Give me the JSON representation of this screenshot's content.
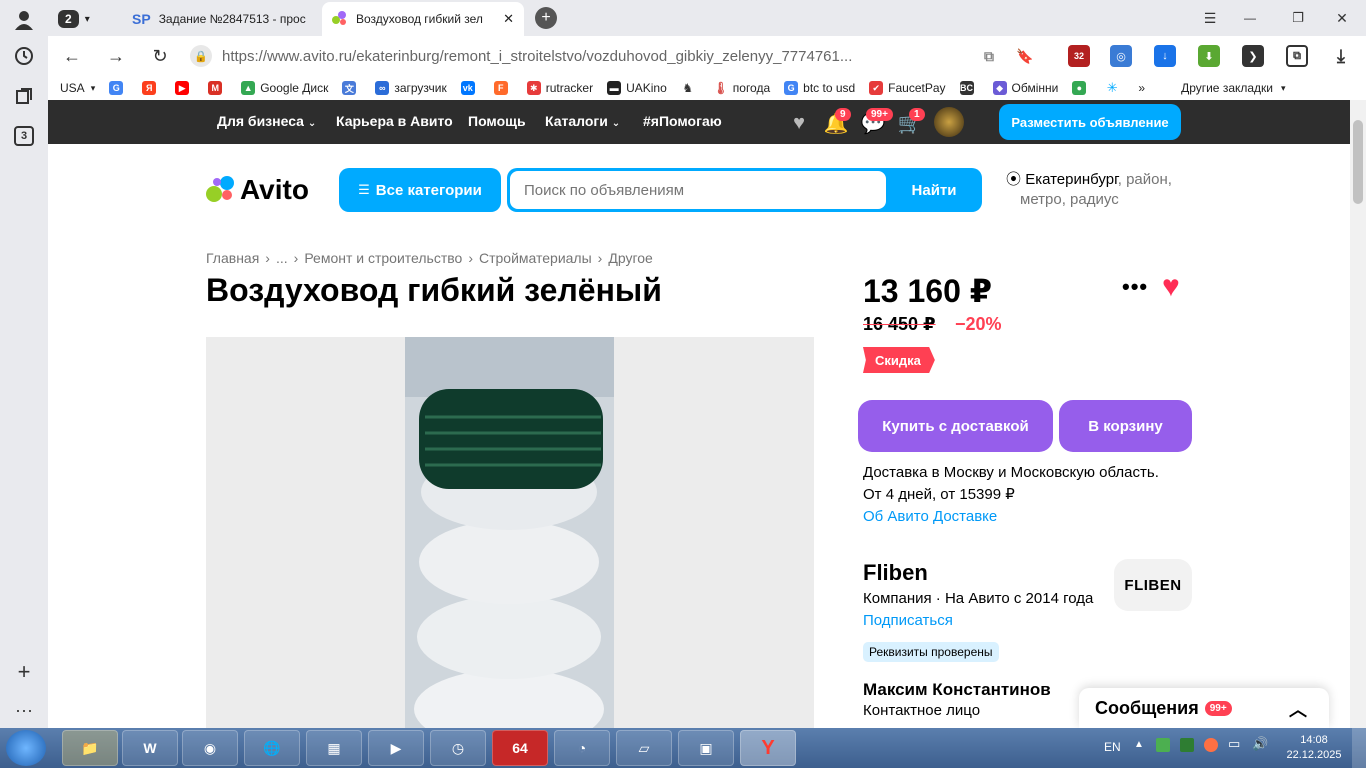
{
  "browser": {
    "rail": {
      "tab_count_badge": "2",
      "stack_badge": "3"
    },
    "tabs": [
      {
        "label": "Задание №2847513 - прос"
      },
      {
        "label": "Воздуховод гибкий зел"
      }
    ],
    "sp_favicon": "SP",
    "url": "https://www.avito.ru/ekaterinburg/remont_i_stroitelstvo/vozduhovod_gibkiy_zelenyy_7774761...",
    "ext_badge": "32",
    "bookmarks": [
      {
        "label": "USA",
        "icon": "chevron-down-icon",
        "color": "#999999"
      },
      {
        "label": "",
        "icon": "google-icon",
        "color": "#4285f4"
      },
      {
        "label": "",
        "icon": "yandex-icon",
        "color": "#fc3f1d"
      },
      {
        "label": "",
        "icon": "youtube-icon",
        "color": "#ff0000"
      },
      {
        "label": "",
        "icon": "gmail-icon",
        "color": "#d93025"
      },
      {
        "label": "Google Диск",
        "icon": "google-drive-icon",
        "color": "#34a853"
      },
      {
        "label": "",
        "icon": "translate-icon",
        "color": "#4a7bd9"
      },
      {
        "label": "загрузчик",
        "icon": "loader-icon",
        "color": "#2b6cd8"
      },
      {
        "label": "",
        "icon": "vk-icon",
        "color": "#0077ff"
      },
      {
        "label": "",
        "icon": "f-icon",
        "color": "#ff6a2b"
      },
      {
        "label": "rutracker",
        "icon": "rutracker-icon",
        "color": "#e63b3b"
      },
      {
        "label": "UAKino",
        "icon": "uakino-icon",
        "color": "#222222"
      },
      {
        "label": "",
        "icon": "horse-icon",
        "color": "#333333"
      },
      {
        "label": "погода",
        "icon": "thermometer-icon",
        "color": "#d9534f"
      },
      {
        "label": "btc to usd",
        "icon": "google-icon",
        "color": "#4285f4"
      },
      {
        "label": "FaucetPay",
        "icon": "faucetpay-icon",
        "color": "#e63b3b"
      },
      {
        "label": "",
        "icon": "bc-icon",
        "color": "#333333"
      },
      {
        "label": "Обмінни",
        "icon": "diamond-icon",
        "color": "#6b5bd6"
      },
      {
        "label": "",
        "icon": "maps-pin-icon",
        "color": "#34a853"
      },
      {
        "label": "",
        "icon": "star-burst-icon",
        "color": "#00aaff"
      }
    ],
    "bookmarks_more": "»",
    "other_bookmarks": "Другие закладки"
  },
  "avito": {
    "topbar": {
      "business": "Для бизнеса",
      "career": "Карьера в Авито",
      "help": "Помощь",
      "catalogs": "Каталоги",
      "help_hashtag": "#яПомогаю",
      "notif_badge": "9",
      "msg_badge": "99+",
      "cart_badge": "1",
      "post_ad": "Разместить объявление"
    },
    "logo_text": "Avito",
    "all_categories": "Все категории",
    "search_placeholder": "Поиск по объявлениям",
    "search_button": "Найти",
    "location": {
      "city": "Екатеринбург",
      "rest_line1": ", район,",
      "line2": "метро, радиус"
    },
    "breadcrumb": [
      "Главная",
      "›",
      "...",
      "›",
      "Ремонт и строительство",
      "›",
      "Стройматериалы",
      "›",
      "Другое"
    ],
    "title": "Воздуховод гибкий зелёный",
    "price": "13 160 ₽",
    "old_price": "16 450 ₽",
    "discount": "−20%",
    "sale_badge": "Скидка",
    "buy_button": "Купить с доставкой",
    "cart_button": "В корзину",
    "delivery_line1": "Доставка в Москву и Московскую область.",
    "delivery_line2": "От 4 дней, от 15399 ₽",
    "delivery_link": "Об Авито Доставке",
    "seller": {
      "name": "Fliben",
      "meta": "Компания · На Авито с 2014 года",
      "subscribe": "Подписаться",
      "verified": "Реквизиты проверены",
      "logo_text": "FLIBEN",
      "contact_name": "Максим Константинов",
      "contact_role": "Контактное лицо"
    },
    "messages": {
      "label": "Сообщения",
      "badge": "99+"
    }
  },
  "taskbar": {
    "app_64": "64",
    "lang": "EN",
    "time": "14:08",
    "date": "22.12.2025"
  },
  "colors": {
    "avito_blue": "#00aaff",
    "avito_purple": "#965eeb",
    "sale_red": "#ff4053",
    "topbar_dark": "#2d2d2d"
  }
}
